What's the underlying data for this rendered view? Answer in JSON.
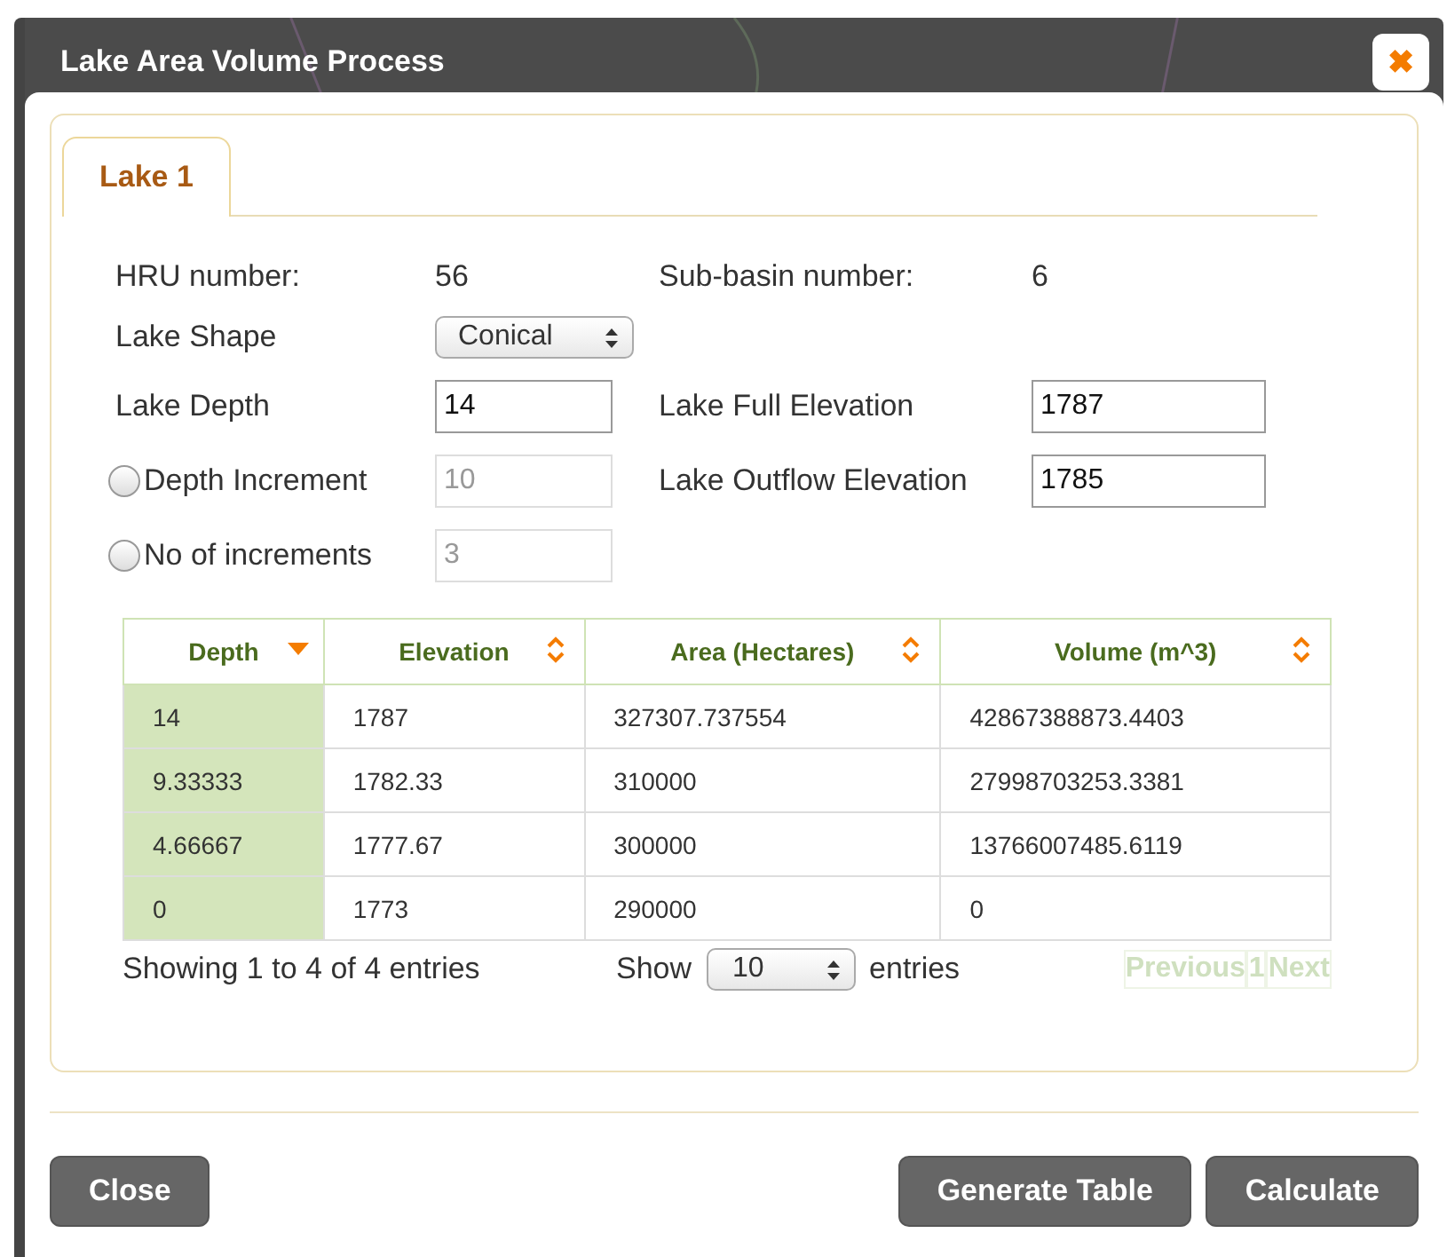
{
  "window": {
    "title": "Lake Area Volume Process",
    "close_label": "✖"
  },
  "tabs": [
    {
      "label": "Lake 1",
      "selected": true
    }
  ],
  "form": {
    "hru_label": "HRU number:",
    "hru_value": "56",
    "subbasin_label": "Sub-basin number:",
    "subbasin_value": "6",
    "shape_label": "Lake Shape",
    "shape_value": "Conical",
    "depth_label": "Lake Depth",
    "depth_value": "14",
    "full_elev_label": "Lake Full Elevation",
    "full_elev_value": "1787",
    "outflow_label": "Lake Outflow Elevation",
    "outflow_value": "1785",
    "options": [
      {
        "label": "Depth Increment",
        "selected": false,
        "value": "10",
        "disabled": true
      },
      {
        "label": "No of increments",
        "selected": false,
        "value": "3",
        "disabled": true
      }
    ]
  },
  "table": {
    "columns": [
      {
        "label": "Depth",
        "sorted": true
      },
      {
        "label": "Elevation",
        "sorted": false
      },
      {
        "label": "Area (Hectares)",
        "sorted": false
      },
      {
        "label": "Volume (m^3)",
        "sorted": false
      }
    ],
    "rows": [
      [
        "14",
        "1787",
        "327307.737554",
        "42867388873.4403"
      ],
      [
        "9.33333",
        "1782.33",
        "310000",
        "27998703253.3381"
      ],
      [
        "4.66667",
        "1777.67",
        "300000",
        "13766007485.6119"
      ],
      [
        "0",
        "1773",
        "290000",
        "0"
      ]
    ],
    "info": "Showing 1 to 4 of 4 entries",
    "show_label": "Show",
    "page_size": "10",
    "entries_label": "entries",
    "pager": [
      {
        "label": "Previous",
        "disabled": true
      },
      {
        "label": "1",
        "disabled": true
      },
      {
        "label": "Next",
        "disabled": true
      }
    ]
  },
  "buttons": [
    {
      "label": "Close",
      "kind": "left"
    },
    {
      "label": "Generate Table",
      "kind": "right"
    },
    {
      "label": "Calculate",
      "kind": "right"
    }
  ]
}
